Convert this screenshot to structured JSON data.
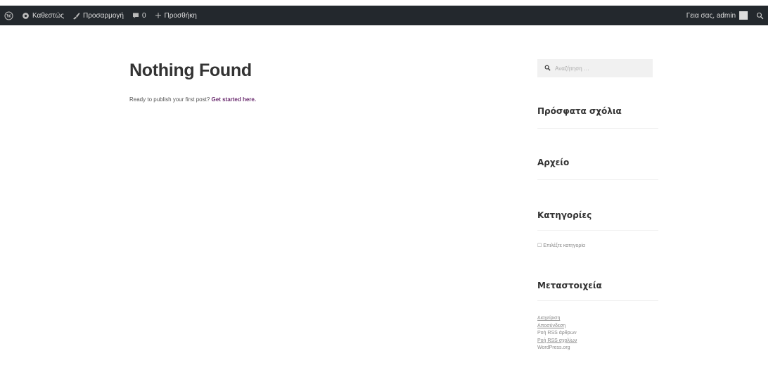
{
  "admin_bar": {
    "site_name": "Καθεστώς",
    "customize": "Προσαρμογή",
    "comments_count": "0",
    "new": "Προσθήκη",
    "greeting": "Γεια σας, admin"
  },
  "main": {
    "title": "Nothing Found",
    "lead_text": "Ready to publish your first post?",
    "lead_link": "Get started here."
  },
  "sidebar": {
    "search_placeholder": "Αναζήτηση …",
    "recent_comments_title": "Πρόσφατα σχόλια",
    "archives_title": "Αρχείο",
    "categories_title": "Κατηγορίες",
    "categories_select": "Επιλέξτε κατηγορία",
    "meta_title": "Μεταστοιχεία",
    "meta_links": [
      "Διαχείριση",
      "Αποσύνδεση",
      "Ροή RSS άρθρων",
      "Ροή RSS σχολίων",
      "WordPress.org"
    ]
  }
}
